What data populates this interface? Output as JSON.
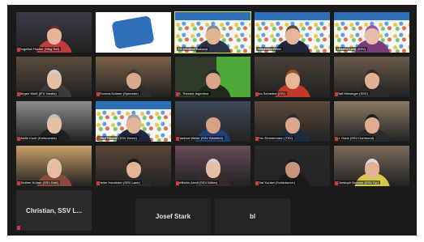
{
  "window": {
    "title": ""
  },
  "participants": [
    {
      "name": "Angelika Fischer (Sfbg Ref)",
      "type": "video",
      "bg": "#3b3a48",
      "skin": "#e7b39b",
      "shirt": "#c03b3b",
      "hair": "#6b2a2a",
      "muted": true
    },
    {
      "name": "",
      "type": "logo",
      "bg": "#ffffff",
      "logo": "#2d6fb8"
    },
    {
      "name": "Dr. Manfred Bakonyi",
      "type": "banner",
      "skin": "#e1b392",
      "shirt": "#2a3347",
      "hair": "#8a8a8a",
      "speaking": true,
      "muted": false
    },
    {
      "name": "Sebastian Keller",
      "type": "banner",
      "skin": "#e4b79c",
      "shirt": "#22263a",
      "hair": "#5a4a3a",
      "muted": false
    },
    {
      "name": "Martina Lang (SSV)",
      "type": "banner",
      "skin": "#e9bda7",
      "shirt": "#7a3b7a",
      "hair": "#9a5aa8",
      "muted": false
    },
    {
      "name": "Jürgen Weiß (IFV Vorsitz)",
      "type": "video",
      "bg": "#5b4b3e",
      "skin": "#e3c0a6",
      "shirt": "#3a3a3a",
      "hair": "#cfcfcf",
      "muted": true
    },
    {
      "name": "Thomas Krämer (Sprecher)",
      "type": "video",
      "bg": "#7b6247",
      "skin": "#dca88c",
      "shirt": "#2d2d2d",
      "hair": "#3a3a3a",
      "muted": true
    },
    {
      "name": "S. Theodor Ingenieur",
      "type": "green",
      "bg": "#2f3a2a",
      "skin": "#d9a488",
      "shirt": "#1e2a1a",
      "hair": "#2a2a2a",
      "muted": true
    },
    {
      "name": "Ina Schreiber (ISV)",
      "type": "video",
      "bg": "#4a4038",
      "skin": "#e8b596",
      "shirt": "#c0392b",
      "hair": "#a0522d",
      "muted": true
    },
    {
      "name": "Ralf Wiesinger (SSV)",
      "type": "video",
      "bg": "#6a5a4a",
      "skin": "#e0b192",
      "shirt": "#2b2b2b",
      "hair": "#3b2a20",
      "muted": true
    },
    {
      "name": "Martin Koch (Kreisvorsitz)",
      "type": "video",
      "bg": "#8c8c8c",
      "skin": "#e6c0a4",
      "shirt": "#1f1f1f",
      "hair": "#bfbfbf",
      "muted": true
    },
    {
      "name": "Gerd Nicolay (SSV Herne)",
      "type": "banner",
      "skin": "#e2b498",
      "shirt": "#20263a",
      "hair": "#a0a0a0",
      "muted": true
    },
    {
      "name": "Hartmut Weiler (SSV Bielefeld)",
      "type": "video",
      "bg": "#3f4a5a",
      "skin": "#d9a184",
      "shirt": "#1f3f7a",
      "hair": "#3a3a3a",
      "muted": true
    },
    {
      "name": "Eric Zimmermann (TSV)",
      "type": "video",
      "bg": "#5a4a3a",
      "skin": "#dba88b",
      "shirt": "#1e2a3e",
      "hair": "#2b2b2b",
      "muted": true
    },
    {
      "name": "U. Gans (SSV Dortmund)",
      "type": "video",
      "bg": "#8a7a62",
      "skin": "#dfae91",
      "shirt": "#2b2b2b",
      "hair": "#1e1e1e",
      "muted": true
    },
    {
      "name": "Günther Kröner (SSV Bühl)",
      "type": "video",
      "bg": "#c9a06a",
      "skin": "#e6bda0",
      "shirt": "#8a4a3a",
      "hair": "#d7c9a0",
      "muted": true
    },
    {
      "name": "Heike Hanrieder (SSV Lanh)",
      "type": "video",
      "bg": "#5a4638",
      "skin": "#e4b497",
      "shirt": "#2a2a2a",
      "hair": "#1e1a18",
      "muted": true
    },
    {
      "name": "Wilhelm Arndt (SSV Bötter)",
      "type": "video",
      "bg": "#6a4a5a",
      "skin": "#e6c0a4",
      "shirt": "#3a2a2a",
      "hair": "#d0d0d0",
      "muted": true
    },
    {
      "name": "Olaf Kunkel (Schiedsrich.)",
      "type": "video",
      "bg": "#2a2a2a",
      "skin": "#c89478",
      "shirt": "#1a1a1a",
      "hair": "#1a1a1a",
      "muted": true
    },
    {
      "name": "Christoph Brunner (SSV Sp.)",
      "type": "video",
      "bg": "#7a6a5a",
      "skin": "#e3b296",
      "shirt": "#d6c94a",
      "hair": "#dcdcdc",
      "muted": true
    },
    {
      "name": "Christian, SSV L...",
      "type": "nameonly",
      "muted": true
    }
  ],
  "bottom_participants": [
    {
      "name": "Josef Stark"
    },
    {
      "name": "bl"
    }
  ]
}
